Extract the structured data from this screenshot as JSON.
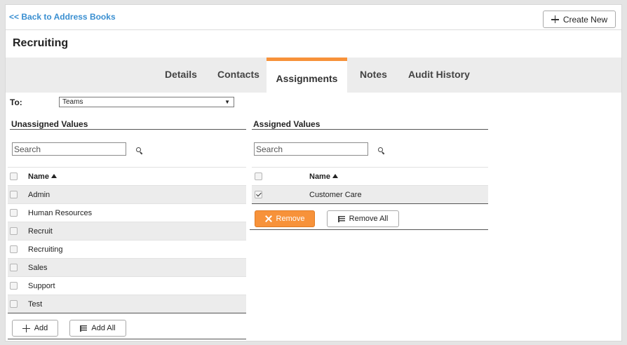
{
  "header": {
    "back_link": "<< Back to Address Books",
    "create_new": "Create New"
  },
  "page_title": "Recruiting",
  "tabs": [
    "Details",
    "Contacts",
    "Assignments",
    "Notes",
    "Audit History"
  ],
  "active_tab": "Assignments",
  "to": {
    "label": "To:",
    "selected": "Teams"
  },
  "unassigned": {
    "title": "Unassigned Values",
    "search_placeholder": "Search",
    "column_header": "Name",
    "items": [
      "Admin",
      "Human Resources",
      "Recruit",
      "Recruiting",
      "Sales",
      "Support",
      "Test"
    ],
    "add_label": "Add",
    "add_all_label": "Add All"
  },
  "assigned": {
    "title": "Assigned Values",
    "search_placeholder": "Search",
    "column_header": "Name",
    "items": [
      "Customer Care"
    ],
    "remove_label": "Remove",
    "remove_all_label": "Remove All"
  },
  "colors": {
    "accent": "#f7923a",
    "link": "#3a8fd1",
    "stripe": "#ececec"
  }
}
